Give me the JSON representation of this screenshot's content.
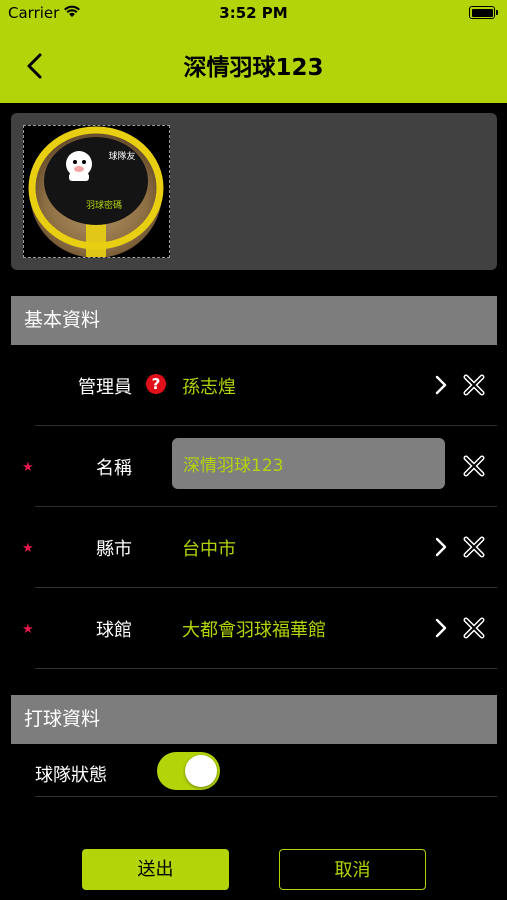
{
  "status_bar": {
    "carrier": "Carrier",
    "time": "3:52 PM",
    "battery_level": 1.0
  },
  "nav": {
    "title": "深情羽球123",
    "back_icon": "chevron-left-icon"
  },
  "photo": {
    "logo_text_top": "球隊友",
    "logo_text_bottom": "羽球密碼"
  },
  "basic_section": {
    "header": "基本資料",
    "rows": [
      {
        "label": "管理員",
        "value": "孫志煌",
        "required": false,
        "has_help": true,
        "has_chevron": true
      },
      {
        "label": "名稱",
        "value": "深情羽球123",
        "required": true,
        "editable": true
      },
      {
        "label": "縣市",
        "value": "台中市",
        "required": true,
        "has_chevron": true
      },
      {
        "label": "球館",
        "value": "大都會羽球福華館",
        "required": true,
        "has_chevron": true
      }
    ],
    "required_mark": "★",
    "help_mark": "?"
  },
  "play_section": {
    "header": "打球資料",
    "team_status_label": "球隊狀態",
    "team_status_on": true
  },
  "footer": {
    "submit_label": "送出",
    "cancel_label": "取消"
  },
  "colors": {
    "accent": "#b4d40a",
    "required": "#e8194a",
    "help": "#e0101a"
  }
}
